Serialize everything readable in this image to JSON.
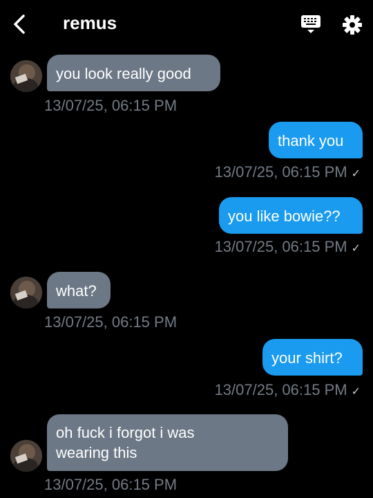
{
  "header": {
    "contact_name": "remus"
  },
  "messages": [
    {
      "direction": "in",
      "text": "you look really good",
      "timestamp": "13/07/25, 06:15 PM"
    },
    {
      "direction": "out",
      "text": "thank you",
      "timestamp": "13/07/25, 06:15 PM",
      "status": "✓"
    },
    {
      "direction": "out",
      "text": "you like bowie??",
      "timestamp": "13/07/25, 06:15 PM",
      "status": "✓"
    },
    {
      "direction": "in",
      "text": "what?",
      "timestamp": "13/07/25, 06:15 PM"
    },
    {
      "direction": "out",
      "text": "your shirt?",
      "timestamp": "13/07/25, 06:15 PM",
      "status": "✓"
    },
    {
      "direction": "in",
      "text_lines": [
        "oh fuck i forgot i was",
        "wearing this"
      ],
      "timestamp": "13/07/25, 06:15 PM"
    }
  ],
  "icons": {
    "back": "chevron-left-icon",
    "keyboard": "keyboard-icon",
    "settings": "gear-icon"
  },
  "colors": {
    "background": "#000000",
    "incoming_bubble": "#6c7886",
    "outgoing_bubble": "#1a9bf0",
    "timestamp": "#737b86"
  }
}
